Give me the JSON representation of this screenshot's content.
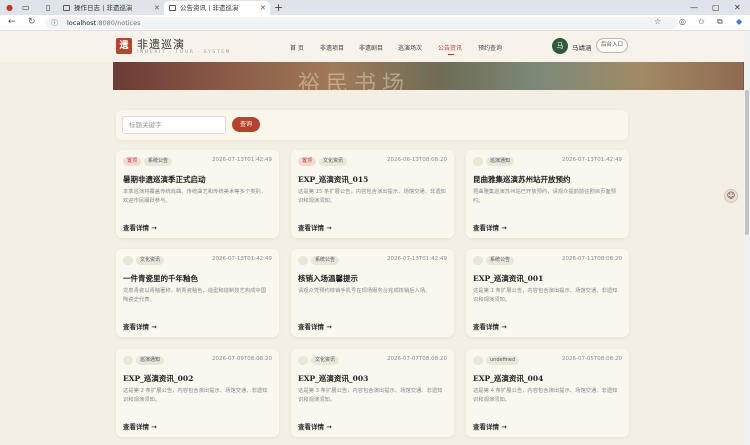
{
  "browser": {
    "tabs": [
      {
        "title": "操作日志 | 非遗巡演"
      },
      {
        "title": "公告资讯 | 非遗巡演"
      }
    ],
    "url_host": "localhost",
    "url_path": ":8080/notices"
  },
  "header": {
    "logo_mark": "遗",
    "title": "非遗巡演",
    "subtitle": "INHERIT · TOUR · SYSTEM",
    "nav": [
      "首 页",
      "非遗项目",
      "非遗剧目",
      "巡演场次",
      "公告资讯",
      "预约查询"
    ],
    "active_nav_index": 4,
    "user_initial": "马",
    "user_name": "马靖涵",
    "backend_label": "后台入口"
  },
  "banner": {
    "text": "裕民书场"
  },
  "search": {
    "placeholder": "标题关键字",
    "value": "",
    "button_label": "查询"
  },
  "cards": [
    {
      "tags": [
        "置顶",
        "系统公告"
      ],
      "date": "2026-07-13T01:42:49",
      "title": "暑期非遗巡演季正式启动",
      "excerpt": "本季巡演将覆盖传统戏曲、传统曲艺和传统美术等多个类别，欢迎市民踊跃参与。",
      "more": "查看详情 →"
    },
    {
      "tags": [
        "置顶",
        "文化资讯"
      ],
      "date": "2026-06-13T08:08:20",
      "title": "EXP_巡演资讯_015",
      "excerpt": "这是第 15 条扩展公告，内容包含演出提示、场馆交通、非遗知识和观演须知。",
      "more": "查看详情 →"
    },
    {
      "tags": [
        "",
        "巡演通知"
      ],
      "date": "2026-07-13T01:42:49",
      "title": "昆曲雅集巡演苏州站开放预约",
      "excerpt": "昆曲雅集巡演苏州站已开放预约，请观众提前前往剧目页面预约。",
      "more": "查看详情 →"
    },
    {
      "tags": [
        "",
        "文化资讯"
      ],
      "date": "2026-07-13T01:42:49",
      "title": "一件青瓷里的千年釉色",
      "excerpt": "龙泉青瓷以青釉著称，制青瓷釉色、造型和烧制技艺构成中国陶瓷史代表。",
      "more": "查看详情 →"
    },
    {
      "tags": [
        "",
        "系统公告"
      ],
      "date": "2026-07-13T01:42:49",
      "title": "核销入场温馨提示",
      "excerpt": "请观众凭预约核销手机号在现场服务台完成核销后入场。",
      "more": "查看详情 →"
    },
    {
      "tags": [
        "",
        "系统公告"
      ],
      "date": "2026-07-11T08:08:20",
      "title": "EXP_巡演资讯_001",
      "excerpt": "这是第 1 条扩展公告，内容包含演出提示、场馆交通、非遗知识和观演须知。",
      "more": "查看详情 →"
    },
    {
      "tags": [
        "",
        "巡演通知"
      ],
      "date": "2026-07-09T08:08:20",
      "title": "EXP_巡演资讯_002",
      "excerpt": "这是第 2 条扩展公告，内容包含演出提示、场馆交通、非遗知识和观演须知。",
      "more": "查看详情 →"
    },
    {
      "tags": [
        "",
        "文化资讯"
      ],
      "date": "2026-07-07T08:08:20",
      "title": "EXP_巡演资讯_003",
      "excerpt": "这是第 3 条扩展公告，内容包含演出提示、场馆交通、非遗知识和观演须知。",
      "more": "查看详情 →"
    },
    {
      "tags": [
        "",
        "undefined"
      ],
      "date": "2026-07-05T08:08:20",
      "title": "EXP_巡演资讯_004",
      "excerpt": "这是第 4 条扩展公告，内容包含演出提示、场馆交通、非遗知识和观演须知。",
      "more": "查看详情 →"
    }
  ]
}
